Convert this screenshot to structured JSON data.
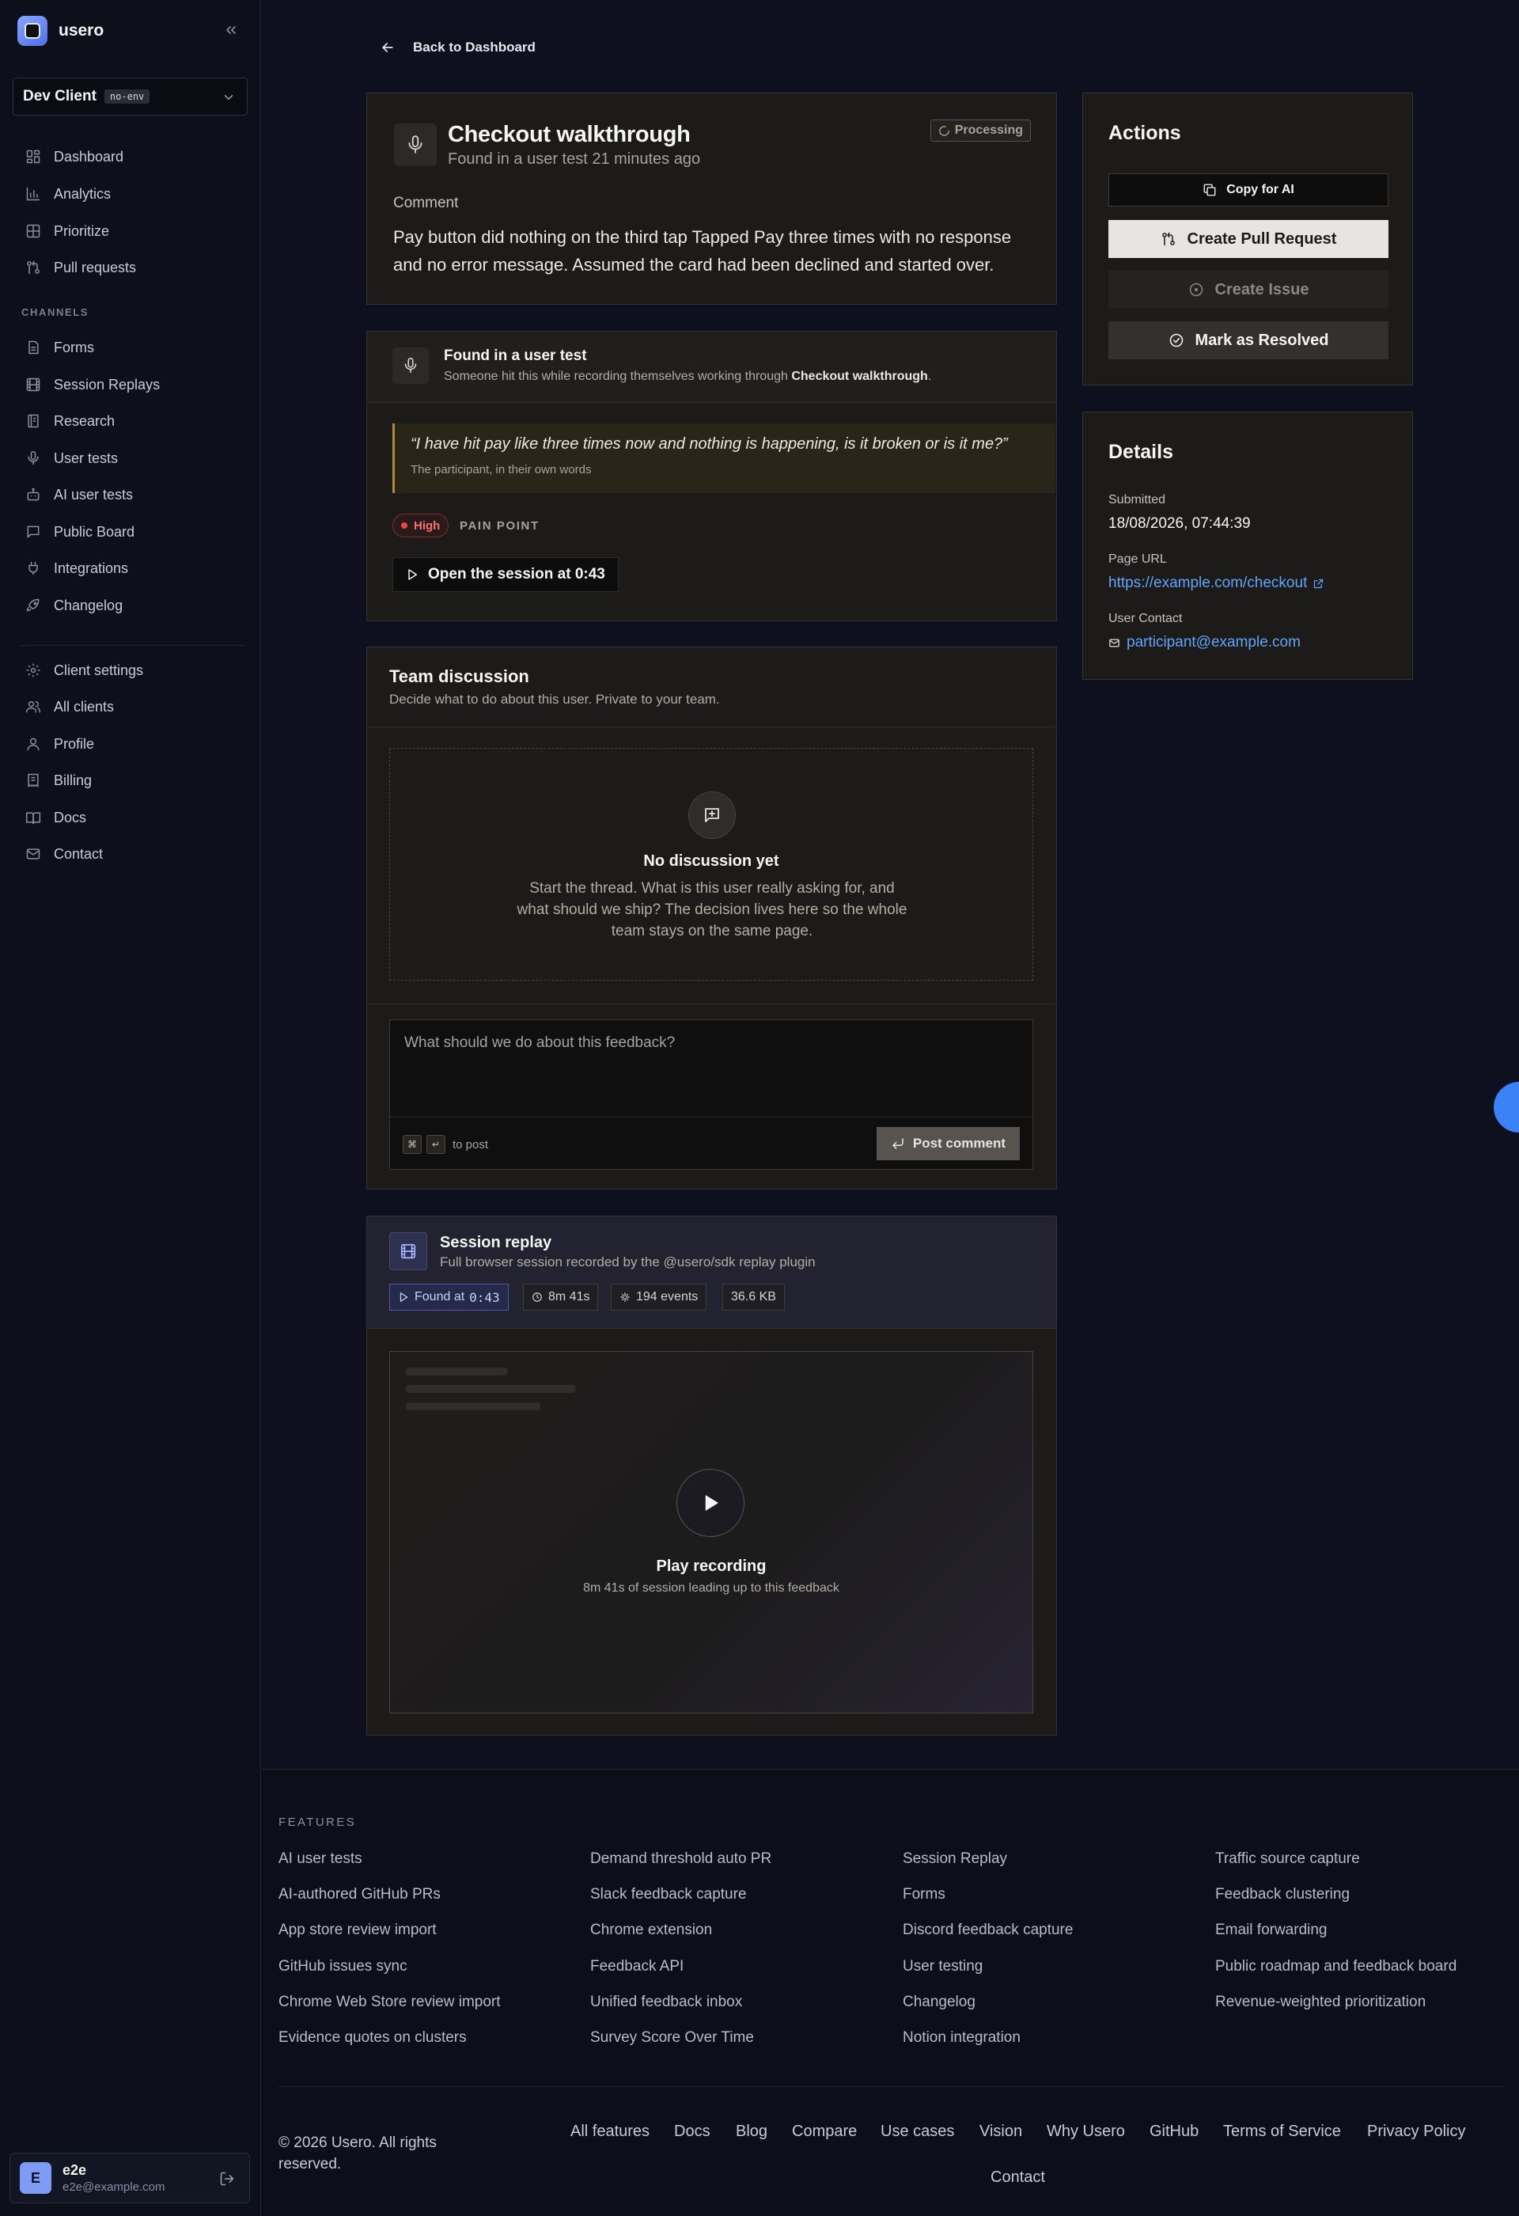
{
  "sidebar": {
    "brand": "usero",
    "client": {
      "name": "Dev Client",
      "env": "no-env"
    },
    "primary": [
      {
        "label": "Dashboard",
        "icon": "dashboard-icon"
      },
      {
        "label": "Analytics",
        "icon": "analytics-icon"
      },
      {
        "label": "Prioritize",
        "icon": "prioritize-icon"
      },
      {
        "label": "Pull requests",
        "icon": "pull-request-icon"
      }
    ],
    "channels_label": "CHANNELS",
    "channels": [
      {
        "label": "Forms",
        "icon": "forms-icon"
      },
      {
        "label": "Session Replays",
        "icon": "film-icon"
      },
      {
        "label": "Research",
        "icon": "research-icon"
      },
      {
        "label": "User tests",
        "icon": "microphone-icon"
      },
      {
        "label": "AI user tests",
        "icon": "bot-icon"
      },
      {
        "label": "Public Board",
        "icon": "message-square-icon"
      },
      {
        "label": "Integrations",
        "icon": "plug-icon"
      },
      {
        "label": "Changelog",
        "icon": "rocket-icon"
      }
    ],
    "secondary": [
      {
        "label": "Client settings",
        "icon": "settings-icon"
      },
      {
        "label": "All clients",
        "icon": "users-icon"
      },
      {
        "label": "Profile",
        "icon": "user-icon"
      },
      {
        "label": "Billing",
        "icon": "receipt-icon"
      },
      {
        "label": "Docs",
        "icon": "book-icon"
      },
      {
        "label": "Contact",
        "icon": "mail-icon"
      }
    ],
    "user": {
      "initial": "E",
      "name": "e2e",
      "email": "e2e@example.com"
    }
  },
  "back_label": "Back to Dashboard",
  "feedback": {
    "title": "Checkout walkthrough",
    "subtitle": "Found in a user test 21 minutes ago",
    "status": "Processing",
    "comment_label": "Comment",
    "comment": "Pay button did nothing on the third tap Tapped Pay three times with no response and no error message. Assumed the card had been declined and started over."
  },
  "user_test": {
    "title": "Found in a user test",
    "subtitle_prefix": "Someone hit this while recording themselves working through ",
    "subtitle_bold": "Checkout walkthrough",
    "subtitle_suffix": ".",
    "quote": "“I have hit pay like three times now and nothing is happening, is it broken or is it me?”",
    "quote_attr": "The participant, in their own words",
    "severity": "High",
    "category": "PAIN POINT",
    "open_session": "Open the session at 0:43"
  },
  "discussion": {
    "title": "Team discussion",
    "subtitle": "Decide what to do about this user. Private to your team.",
    "empty_title": "No discussion yet",
    "empty_body": "Start the thread. What is this user really asking for, and what should we ship? The decision lives here so the whole team stays on the same page.",
    "placeholder": "What should we do about this feedback?",
    "kbd_cmd": "⌘",
    "kbd_enter": "↵",
    "to_post": "to post",
    "post_button": "Post comment"
  },
  "replay": {
    "title": "Session replay",
    "subtitle": "Full browser session recorded by the @usero/sdk replay plugin",
    "found_label": "Found at",
    "found_time": "0:43",
    "duration": "8m 41s",
    "events": "194 events",
    "size": "36.6 KB",
    "play_title": "Play recording",
    "play_sub": "8m 41s of session leading up to this feedback"
  },
  "actions": {
    "title": "Actions",
    "copy_ai": "Copy for AI",
    "create_pr": "Create Pull Request",
    "create_issue": "Create Issue",
    "resolve": "Mark as Resolved"
  },
  "details": {
    "title": "Details",
    "submitted_label": "Submitted",
    "submitted": "18/08/2026, 07:44:39",
    "page_url_label": "Page URL",
    "page_url": "https://example.com/checkout",
    "contact_label": "User Contact",
    "contact": "participant@example.com"
  },
  "footer": {
    "features_label": "FEATURES",
    "features": [
      [
        "AI user tests",
        "AI-authored GitHub PRs",
        "App store review import",
        "GitHub issues sync",
        "Chrome Web Store review import",
        "Evidence quotes on clusters"
      ],
      [
        "Demand threshold auto PR",
        "Slack feedback capture",
        "Chrome extension",
        "Feedback API",
        "Unified feedback inbox",
        "Survey Score Over Time"
      ],
      [
        "Session Replay",
        "Forms",
        "Discord feedback capture",
        "User testing",
        "Changelog",
        "Notion integration"
      ],
      [
        "Traffic source capture",
        "Feedback clustering",
        "Email forwarding",
        "Public roadmap and feedback board",
        "Revenue-weighted prioritization"
      ]
    ],
    "copyright": "© 2026 Usero. All rights reserved.",
    "links": [
      "All features",
      "Docs",
      "Blog",
      "Compare",
      "Use cases",
      "Vision",
      "Why Usero",
      "GitHub",
      "Terms of Service",
      "Privacy Policy"
    ],
    "contact": "Contact"
  },
  "colors": {
    "accent": "#3b82f6",
    "link": "#60a5fa",
    "severity_high": "#ef4444",
    "primary_button": "#e7e5e4"
  }
}
